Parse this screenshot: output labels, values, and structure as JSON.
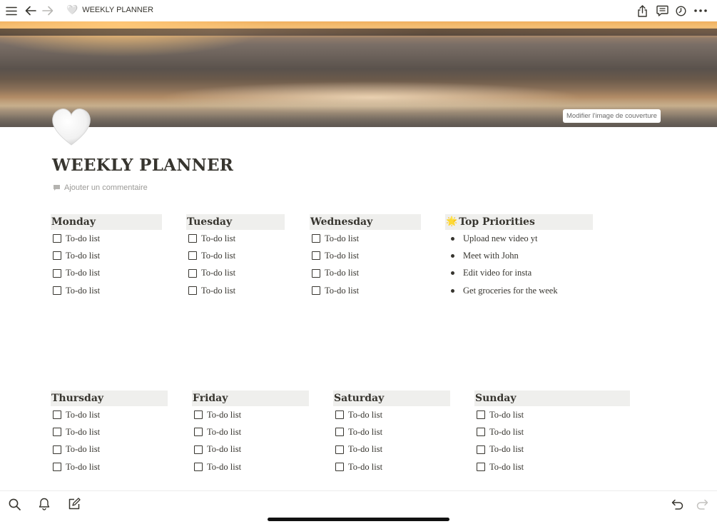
{
  "topbar": {
    "title": "WEEKLY PLANNER",
    "title_emoji": "🤍"
  },
  "cover": {
    "change_button": "Modifier l'image de couverture"
  },
  "page": {
    "icon": "white-heart-icon",
    "title": "WEEKLY PLANNER",
    "add_comment": "Ajouter un commentaire"
  },
  "row1": [
    {
      "header": "Monday",
      "items": [
        "To-do list",
        "To-do list",
        "To-do list",
        "To-do list"
      ]
    },
    {
      "header": "Tuesday",
      "items": [
        "To-do list",
        "To-do list",
        "To-do list",
        "To-do list"
      ]
    },
    {
      "header": "Wednesday",
      "items": [
        "To-do list",
        "To-do list",
        "To-do list",
        "To-do list"
      ]
    }
  ],
  "priorities": {
    "emoji": "🌟",
    "header": "Top Priorities",
    "items": [
      "Upload new video yt",
      "Meet with John",
      "Edit video for insta",
      "Get groceries for the week"
    ]
  },
  "row2": [
    {
      "header": "Thursday",
      "items": [
        "To-do list",
        "To-do list",
        "To-do list",
        "To-do list"
      ]
    },
    {
      "header": "Friday",
      "items": [
        "To-do list",
        "To-do list",
        "To-do list",
        "To-do list"
      ]
    },
    {
      "header": "Saturday",
      "items": [
        "To-do list",
        "To-do list",
        "To-do list",
        "To-do list"
      ]
    },
    {
      "header": "Sunday",
      "items": [
        "To-do list",
        "To-do list",
        "To-do list",
        "To-do list"
      ]
    }
  ]
}
